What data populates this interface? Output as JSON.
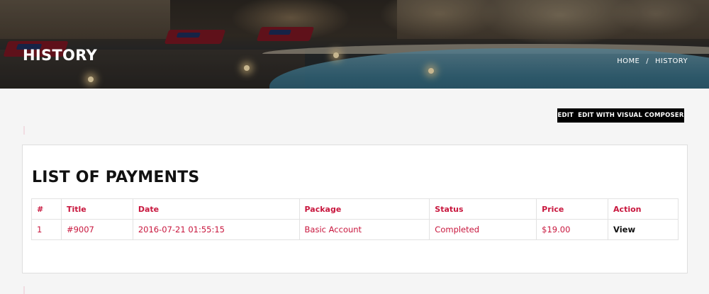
{
  "header": {
    "title": "HISTORY",
    "breadcrumb": {
      "home": "HOME",
      "separator": "/",
      "current": "HISTORY"
    }
  },
  "toolbar": {
    "edit_label": "EDIT",
    "edit_visual_label": "EDIT WITH VISUAL COMPOSER"
  },
  "payments": {
    "title": "LIST OF PAYMENTS",
    "columns": [
      "#",
      "Title",
      "Date",
      "Package",
      "Status",
      "Price",
      "Action"
    ],
    "rows": [
      {
        "num": "1",
        "title": "#9007",
        "date": "2016-07-21 01:55:15",
        "package": "Basic Account",
        "status": "Completed",
        "price": "$19.00",
        "action": "View"
      }
    ]
  },
  "colors": {
    "accent": "#c8163d",
    "button_bg": "#000000",
    "page_bg": "#f5f5f5"
  }
}
